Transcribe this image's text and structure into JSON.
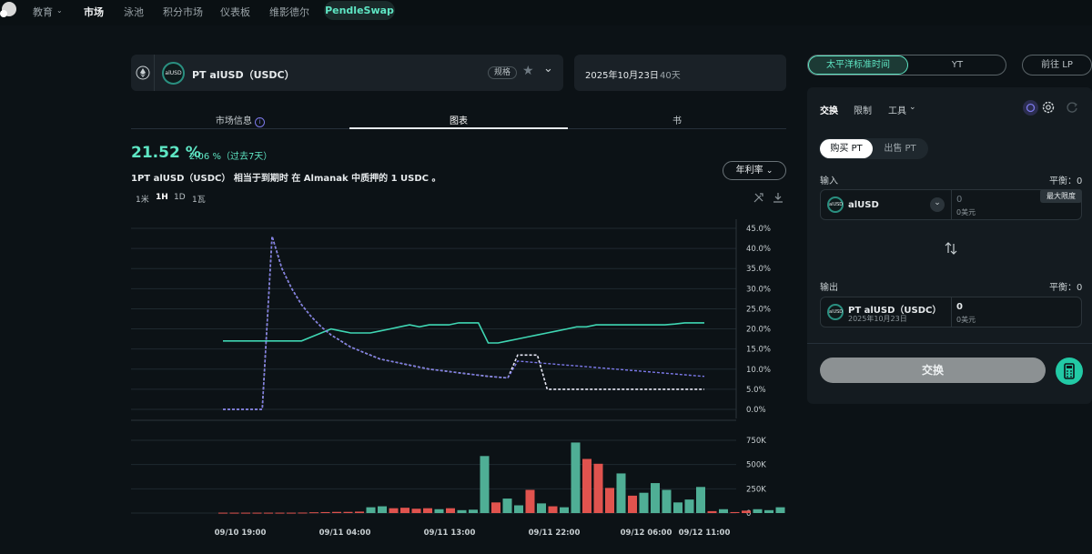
{
  "nav": {
    "items": [
      "教育",
      "市场",
      "泳池",
      "积分市场",
      "仪表板",
      "维影德尔"
    ],
    "active": "市场",
    "pill": "PendleSwap"
  },
  "market": {
    "token_icon_text": "alUSD",
    "name": "PT alUSD（USDC）",
    "spec_badge": "规格",
    "expiry_date": "2025年10月23日",
    "days_left": "40天"
  },
  "tabs": [
    "市场信息",
    "图表",
    "书"
  ],
  "active_tab": "图表",
  "summary": {
    "rate": "21.52 %",
    "change": "2.06 %（过去7天）",
    "description": "1PT alUSD（USDC） 相当于到期时 在 Almanak 中质押的 1 USDC 。",
    "dropdown": "年利率"
  },
  "timeframes": [
    "1米",
    "1H",
    "1D",
    "1瓦"
  ],
  "active_timeframe": "1H",
  "chart_data": {
    "type": "line",
    "x": [
      "09/10 19:00",
      "09/11 04:00",
      "09/11 13:00",
      "09/11 22:00",
      "09/12 06:00",
      "09/12 11:00"
    ],
    "y_ticks": [
      "45.0%",
      "40.0%",
      "35.0%",
      "30.0%",
      "25.0%",
      "20.0%",
      "15.0%",
      "10.0%",
      "5.0%",
      "0.0%"
    ],
    "ylim": [
      0,
      45
    ],
    "series": [
      {
        "color": "#3fd6b3",
        "style": "solid",
        "values": [
          17.0,
          17.0,
          17.0,
          17.0,
          17.0,
          17.0,
          17.0,
          17.0,
          17.0,
          18.0,
          19.0,
          20.0,
          19.5,
          19.0,
          19.0,
          19.0,
          19.5,
          20.0,
          20.5,
          21.0,
          20.5,
          21.0,
          21.0,
          21.0,
          21.5,
          21.5,
          21.5,
          16.5,
          16.5,
          17.0,
          17.5,
          18.0,
          18.5,
          19.0,
          19.5,
          20.0,
          20.5,
          20.5,
          21.0,
          21.0,
          21.0,
          21.0,
          21.0,
          21.0,
          21.0,
          21.0,
          21.2,
          21.5,
          21.5,
          21.5
        ]
      },
      {
        "color": "#7b78e8",
        "style": "dashed",
        "values": [
          0.0,
          0.0,
          0.0,
          0.0,
          0.0,
          43.0,
          35.0,
          30.0,
          26.0,
          23.0,
          20.5,
          18.5,
          17.0,
          15.5,
          14.5,
          13.5,
          12.5,
          12.0,
          11.5,
          11.0,
          10.5,
          10.0,
          9.7,
          9.4,
          9.1,
          8.8,
          8.5,
          8.2,
          8.0,
          7.8,
          13.5,
          13.5,
          13.5,
          5.0,
          5.0,
          5.0,
          5.0,
          5.0,
          5.0,
          5.0,
          5.0,
          5.0,
          5.0,
          5.0,
          5.0,
          5.0,
          5.0,
          5.0,
          5.0,
          5.0
        ],
        "alt_values": [
          0.0,
          0.0,
          0.0,
          0.0,
          0.0,
          43.0,
          35.0,
          30.0,
          26.0,
          23.0,
          20.5,
          18.5,
          17.0,
          15.5,
          14.5,
          13.5,
          12.5,
          12.0,
          11.5,
          11.0,
          10.5,
          10.0,
          9.7,
          9.4,
          9.1,
          8.8,
          8.5,
          8.2,
          8.0,
          7.8,
          12.0,
          11.8,
          11.6,
          11.4,
          11.2,
          11.0,
          10.8,
          10.6,
          10.4,
          10.2,
          10.0,
          9.8,
          9.6,
          9.4,
          9.2,
          9.0,
          8.8,
          8.6,
          8.4,
          8.2
        ]
      }
    ],
    "volume": {
      "y_ticks": [
        "750K",
        "500K",
        "250K",
        "0"
      ],
      "ylim": [
        0,
        800000
      ],
      "bars": [
        {
          "v": 4000,
          "c": "r"
        },
        {
          "v": 4000,
          "c": "r"
        },
        {
          "v": 4000,
          "c": "r"
        },
        {
          "v": 4000,
          "c": "r"
        },
        {
          "v": 4000,
          "c": "r"
        },
        {
          "v": 4000,
          "c": "r"
        },
        {
          "v": 4000,
          "c": "r"
        },
        {
          "v": 5000,
          "c": "r"
        },
        {
          "v": 8000,
          "c": "r"
        },
        {
          "v": 10000,
          "c": "r"
        },
        {
          "v": 12000,
          "c": "r"
        },
        {
          "v": 12000,
          "c": "r"
        },
        {
          "v": 15000,
          "c": "r"
        },
        {
          "v": 60000,
          "c": "g"
        },
        {
          "v": 70000,
          "c": "g"
        },
        {
          "v": 50000,
          "c": "r"
        },
        {
          "v": 55000,
          "c": "r"
        },
        {
          "v": 45000,
          "c": "r"
        },
        {
          "v": 50000,
          "c": "r"
        },
        {
          "v": 40000,
          "c": "g"
        },
        {
          "v": 50000,
          "c": "r"
        },
        {
          "v": 30000,
          "c": "g"
        },
        {
          "v": 35000,
          "c": "g"
        },
        {
          "v": 590000,
          "c": "g"
        },
        {
          "v": 110000,
          "c": "r"
        },
        {
          "v": 150000,
          "c": "g"
        },
        {
          "v": 80000,
          "c": "g"
        },
        {
          "v": 240000,
          "c": "r"
        },
        {
          "v": 100000,
          "c": "g"
        },
        {
          "v": 70000,
          "c": "r"
        },
        {
          "v": 60000,
          "c": "g"
        },
        {
          "v": 730000,
          "c": "g"
        },
        {
          "v": 560000,
          "c": "r"
        },
        {
          "v": 510000,
          "c": "r"
        },
        {
          "v": 260000,
          "c": "r"
        },
        {
          "v": 410000,
          "c": "g"
        },
        {
          "v": 180000,
          "c": "r"
        },
        {
          "v": 210000,
          "c": "g"
        },
        {
          "v": 310000,
          "c": "g"
        },
        {
          "v": 240000,
          "c": "g"
        },
        {
          "v": 110000,
          "c": "g"
        },
        {
          "v": 140000,
          "c": "g"
        },
        {
          "v": 270000,
          "c": "g"
        },
        {
          "v": 20000,
          "c": "r"
        },
        {
          "v": 40000,
          "c": "g"
        },
        {
          "v": 10000,
          "c": "r"
        },
        {
          "v": 25000,
          "c": "r"
        },
        {
          "v": 40000,
          "c": "g"
        },
        {
          "v": 30000,
          "c": "g"
        },
        {
          "v": 60000,
          "c": "g"
        },
        {
          "v": 40000,
          "c": "r"
        },
        {
          "v": 30000,
          "c": "r"
        },
        {
          "v": 60000,
          "c": "g"
        }
      ]
    }
  },
  "swap_panel": {
    "mode_active": "太平洋标准时间",
    "mode_other": "YT",
    "lp_button": "前往 LP",
    "tabs": [
      "交换",
      "限制",
      "工具"
    ],
    "buy": "购买 PT",
    "sell": "出售 PT",
    "input_label": "输入",
    "input_balance": "平衡：0",
    "input_token": "alUSD",
    "input_amount": "0",
    "input_usd": "0美元",
    "max_tooltip": "最大限度",
    "output_label": "输出",
    "output_balance": "平衡：0",
    "output_token": "PT alUSD（USDC）",
    "output_date": "2025年10月23日",
    "output_amount": "0",
    "output_usd": "0美元",
    "swap_button": "交换"
  },
  "colors": {
    "accent": "#5ee5c3",
    "up": "#4fae95",
    "down": "#e0534e",
    "apy_line": "#3fd6b3",
    "implied_line": "#7b78e8"
  }
}
